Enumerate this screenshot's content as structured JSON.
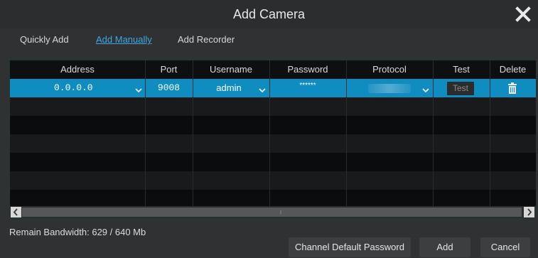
{
  "window": {
    "title": "Add Camera"
  },
  "tabs": [
    {
      "label": "Quickly Add",
      "active": false
    },
    {
      "label": "Add Manually",
      "active": true
    },
    {
      "label": "Add Recorder",
      "active": false
    }
  ],
  "table": {
    "columns": [
      "Address",
      "Port",
      "Username",
      "Password",
      "Protocol",
      "Test",
      "Delete"
    ],
    "rows": [
      {
        "address": "0.0.0.0",
        "port": "9008",
        "username": "admin",
        "password": "******",
        "protocol": "",
        "test_label": "Test"
      }
    ]
  },
  "status": {
    "bandwidth": "Remain Bandwidth: 629 / 640 Mb"
  },
  "buttons": {
    "channel_default_password": "Channel Default Password",
    "add": "Add",
    "cancel": "Cancel"
  },
  "icons": {
    "close": "close-icon",
    "dropdown": "chevron-down-icon",
    "delete": "trash-icon",
    "scroll_left": "arrow-left-icon",
    "scroll_right": "arrow-right-icon"
  },
  "colors": {
    "accent": "#0f8cc0",
    "link": "#3fa7e4",
    "background": "#2f3133"
  }
}
